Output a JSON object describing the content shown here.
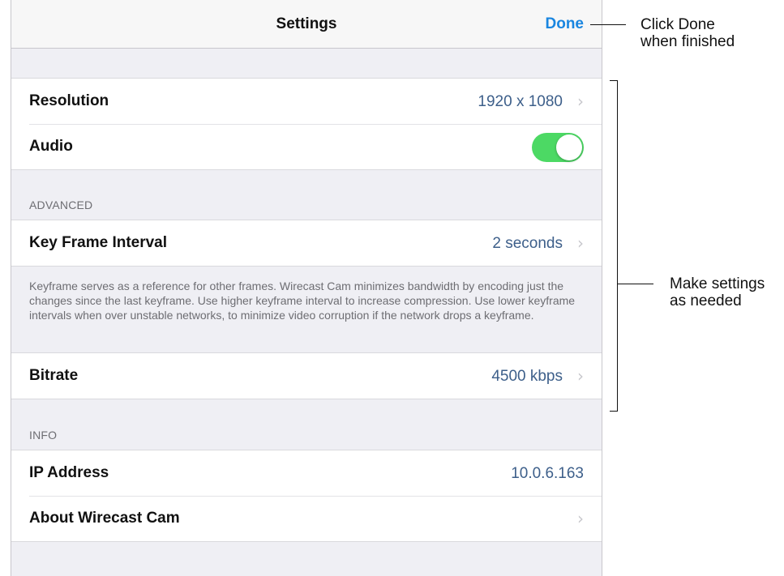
{
  "navbar": {
    "title": "Settings",
    "done_label": "Done"
  },
  "main_group": {
    "resolution": {
      "label": "Resolution",
      "value": "1920 x 1080"
    },
    "audio": {
      "label": "Audio",
      "enabled": true
    }
  },
  "advanced": {
    "header": "ADVANCED",
    "key_frame": {
      "label": "Key Frame Interval",
      "value": "2 seconds"
    },
    "footer": "Keyframe serves as a reference for other frames. Wirecast Cam minimizes bandwidth by encoding just the changes since the last keyframe. Use higher keyframe interval to increase compression.  Use lower keyframe intervals when over unstable networks, to minimize video corruption if the network drops a keyframe.",
    "bitrate": {
      "label": "Bitrate",
      "value": "4500 kbps"
    }
  },
  "info": {
    "header": "INFO",
    "ip": {
      "label": "IP Address",
      "value": "10.0.6.163"
    },
    "about": {
      "label": "About Wirecast Cam"
    }
  },
  "annotations": {
    "done_note": "Click Done\nwhen finished",
    "settings_note": "Make settings\nas needed"
  },
  "colors": {
    "accent": "#1a86e0",
    "toggle_on": "#4cd964",
    "value": "#3d5f8a"
  },
  "icons": {
    "chevron": "›"
  }
}
